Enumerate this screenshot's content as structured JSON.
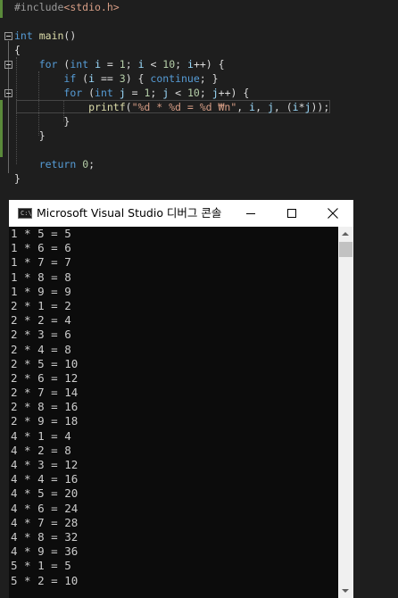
{
  "editor": {
    "lines": [
      [
        "#include",
        "<stdio.h>"
      ],
      [],
      [
        "int",
        " ",
        "main",
        "()"
      ],
      [
        "{"
      ],
      [
        "    ",
        "for",
        " (",
        "int",
        " ",
        "i",
        " = ",
        "1",
        "; ",
        "i",
        " < ",
        "10",
        "; ",
        "i",
        "++) {"
      ],
      [
        "        ",
        "if",
        " (",
        "i",
        " == ",
        "3",
        ") { ",
        "continue",
        "; }"
      ],
      [
        "        ",
        "for",
        " (",
        "int",
        " ",
        "j",
        " = ",
        "1",
        "; ",
        "j",
        " < ",
        "10",
        "; ",
        "j",
        "++) {"
      ],
      [
        "            ",
        "printf",
        "(",
        "\"%d * %d = %d ₩n\"",
        ", ",
        "i",
        ", ",
        "j",
        ", (",
        "i",
        "*",
        "j",
        "));"
      ],
      [
        "        ",
        "}"
      ],
      [
        "    ",
        "}"
      ],
      [],
      [
        "    ",
        "return",
        " ",
        "0",
        ";"
      ],
      [
        "}"
      ]
    ]
  },
  "console": {
    "title": "Microsoft Visual Studio 디버그 콘솔",
    "icon": "console-app-icon",
    "icon_label": "C:\\",
    "buttons": [
      "minimize-icon",
      "maximize-icon",
      "close-icon"
    ],
    "output": [
      "1 * 5 = 5",
      "1 * 6 = 6",
      "1 * 7 = 7",
      "1 * 8 = 8",
      "1 * 9 = 9",
      "2 * 1 = 2",
      "2 * 2 = 4",
      "2 * 3 = 6",
      "2 * 4 = 8",
      "2 * 5 = 10",
      "2 * 6 = 12",
      "2 * 7 = 14",
      "2 * 8 = 16",
      "2 * 9 = 18",
      "4 * 1 = 4",
      "4 * 2 = 8",
      "4 * 3 = 12",
      "4 * 4 = 16",
      "4 * 5 = 20",
      "4 * 6 = 24",
      "4 * 7 = 28",
      "4 * 8 = 32",
      "4 * 9 = 36",
      "5 * 1 = 5",
      "5 * 2 = 10"
    ]
  },
  "colors": {
    "editor_bg": "#1e1e1e",
    "keyword": "#569cd6",
    "string": "#d69d85",
    "function": "#dcdcaa",
    "number": "#b5cea8",
    "variable": "#9cdcfe",
    "console_bg": "#0c0c0c",
    "console_text": "#cccccc",
    "titlebar_bg": "#ffffff"
  }
}
